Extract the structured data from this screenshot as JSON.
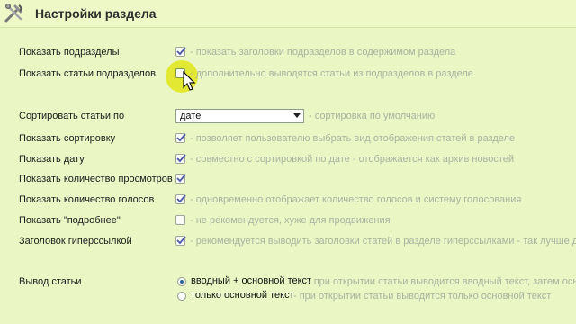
{
  "header": {
    "title": "Настройки раздела",
    "icon": "tools-icon"
  },
  "settings": [
    {
      "label": "Показать подразделы",
      "control": "checkbox",
      "checked": true,
      "hint": "- показать заголовки подразделов в содержимом раздела"
    },
    {
      "label": "Показать статьи подразделов",
      "control": "checkbox",
      "checked": false,
      "hint": "- дополнительно выводятся статьи из подразделов в разделе"
    },
    {
      "label": "Сортировать статьи по",
      "control": "select",
      "value": "дате",
      "hint": "- сортировка по умолчанию"
    },
    {
      "label": "Показать сортировку",
      "control": "checkbox",
      "checked": true,
      "hint": "- позволяет пользователю выбрать вид отображения статей в разделе"
    },
    {
      "label": "Показать дату",
      "control": "checkbox",
      "checked": true,
      "hint": "- совместно с сортировкой по дате - отображается как архив новостей"
    },
    {
      "label": "Показать количество просмотров",
      "control": "checkbox",
      "checked": true,
      "hint": ""
    },
    {
      "label": "Показать количество голосов",
      "control": "checkbox",
      "checked": true,
      "hint": "- одновременно отображает количество голосов и систему голосования"
    },
    {
      "label": "Показать \"подробнее\"",
      "control": "checkbox",
      "checked": false,
      "hint": "- не рекомендуется, хуже для продвижения"
    },
    {
      "label": "Заголовок гиперссылкой",
      "control": "checkbox",
      "checked": true,
      "hint": "- рекомендуется выводить заголовки статей в разделе гиперссылками - так лучше для п"
    }
  ],
  "article_output": {
    "label": "Вывод статьи",
    "options": [
      {
        "label": "вводный + основной текст",
        "checked": true,
        "hint": "- при открытии статьи выводится вводный текст, затем основн"
      },
      {
        "label": "только основной текст",
        "checked": false,
        "hint": "- при открытии статьи выводится только основной текст"
      }
    ]
  },
  "colors": {
    "background": "#eaf6c4",
    "header_background": "#eef7c6",
    "hint_text": "#a9b3a0",
    "cursor_highlight": "#e3e82a",
    "checkmark": "#4c59a8"
  }
}
